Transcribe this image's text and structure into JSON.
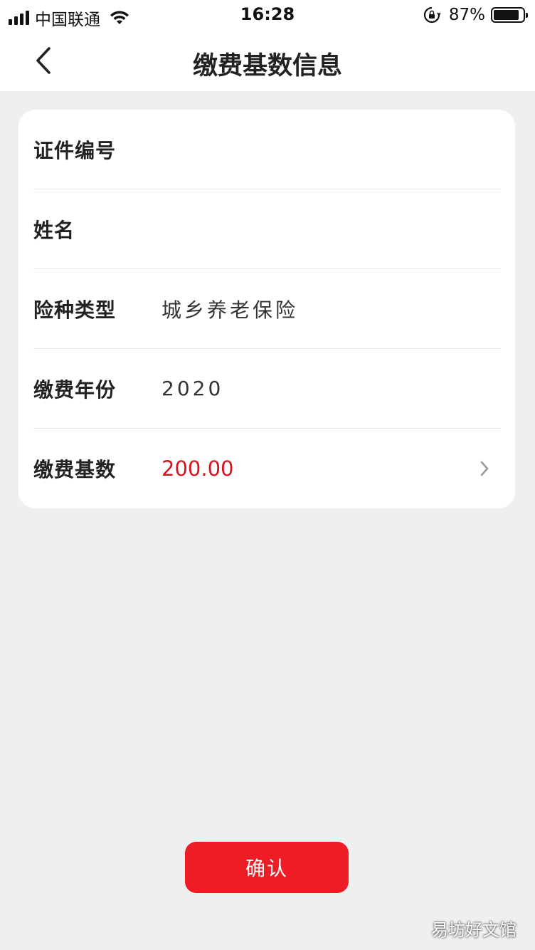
{
  "status_bar": {
    "carrier": "中国联通",
    "time": "16:28",
    "battery_percent_label": "87%",
    "battery_level": 0.87
  },
  "nav": {
    "title": "缴费基数信息"
  },
  "form": {
    "rows": [
      {
        "label": "证件编号",
        "value": ""
      },
      {
        "label": "姓名",
        "value": ""
      },
      {
        "label": "险种类型",
        "value": "城乡养老保险"
      },
      {
        "label": "缴费年份",
        "value": "2020"
      },
      {
        "label": "缴费基数",
        "value": "200.00"
      }
    ]
  },
  "actions": {
    "confirm_label": "确认"
  },
  "watermark": "易坊好文馆",
  "colors": {
    "accent_red": "#ee1c24",
    "value_red": "#d7141e",
    "background": "#efefef"
  },
  "icons": [
    "signal-icon",
    "wifi-icon",
    "rotation-lock-icon",
    "battery-icon",
    "back-chevron-icon",
    "chevron-right-icon"
  ]
}
